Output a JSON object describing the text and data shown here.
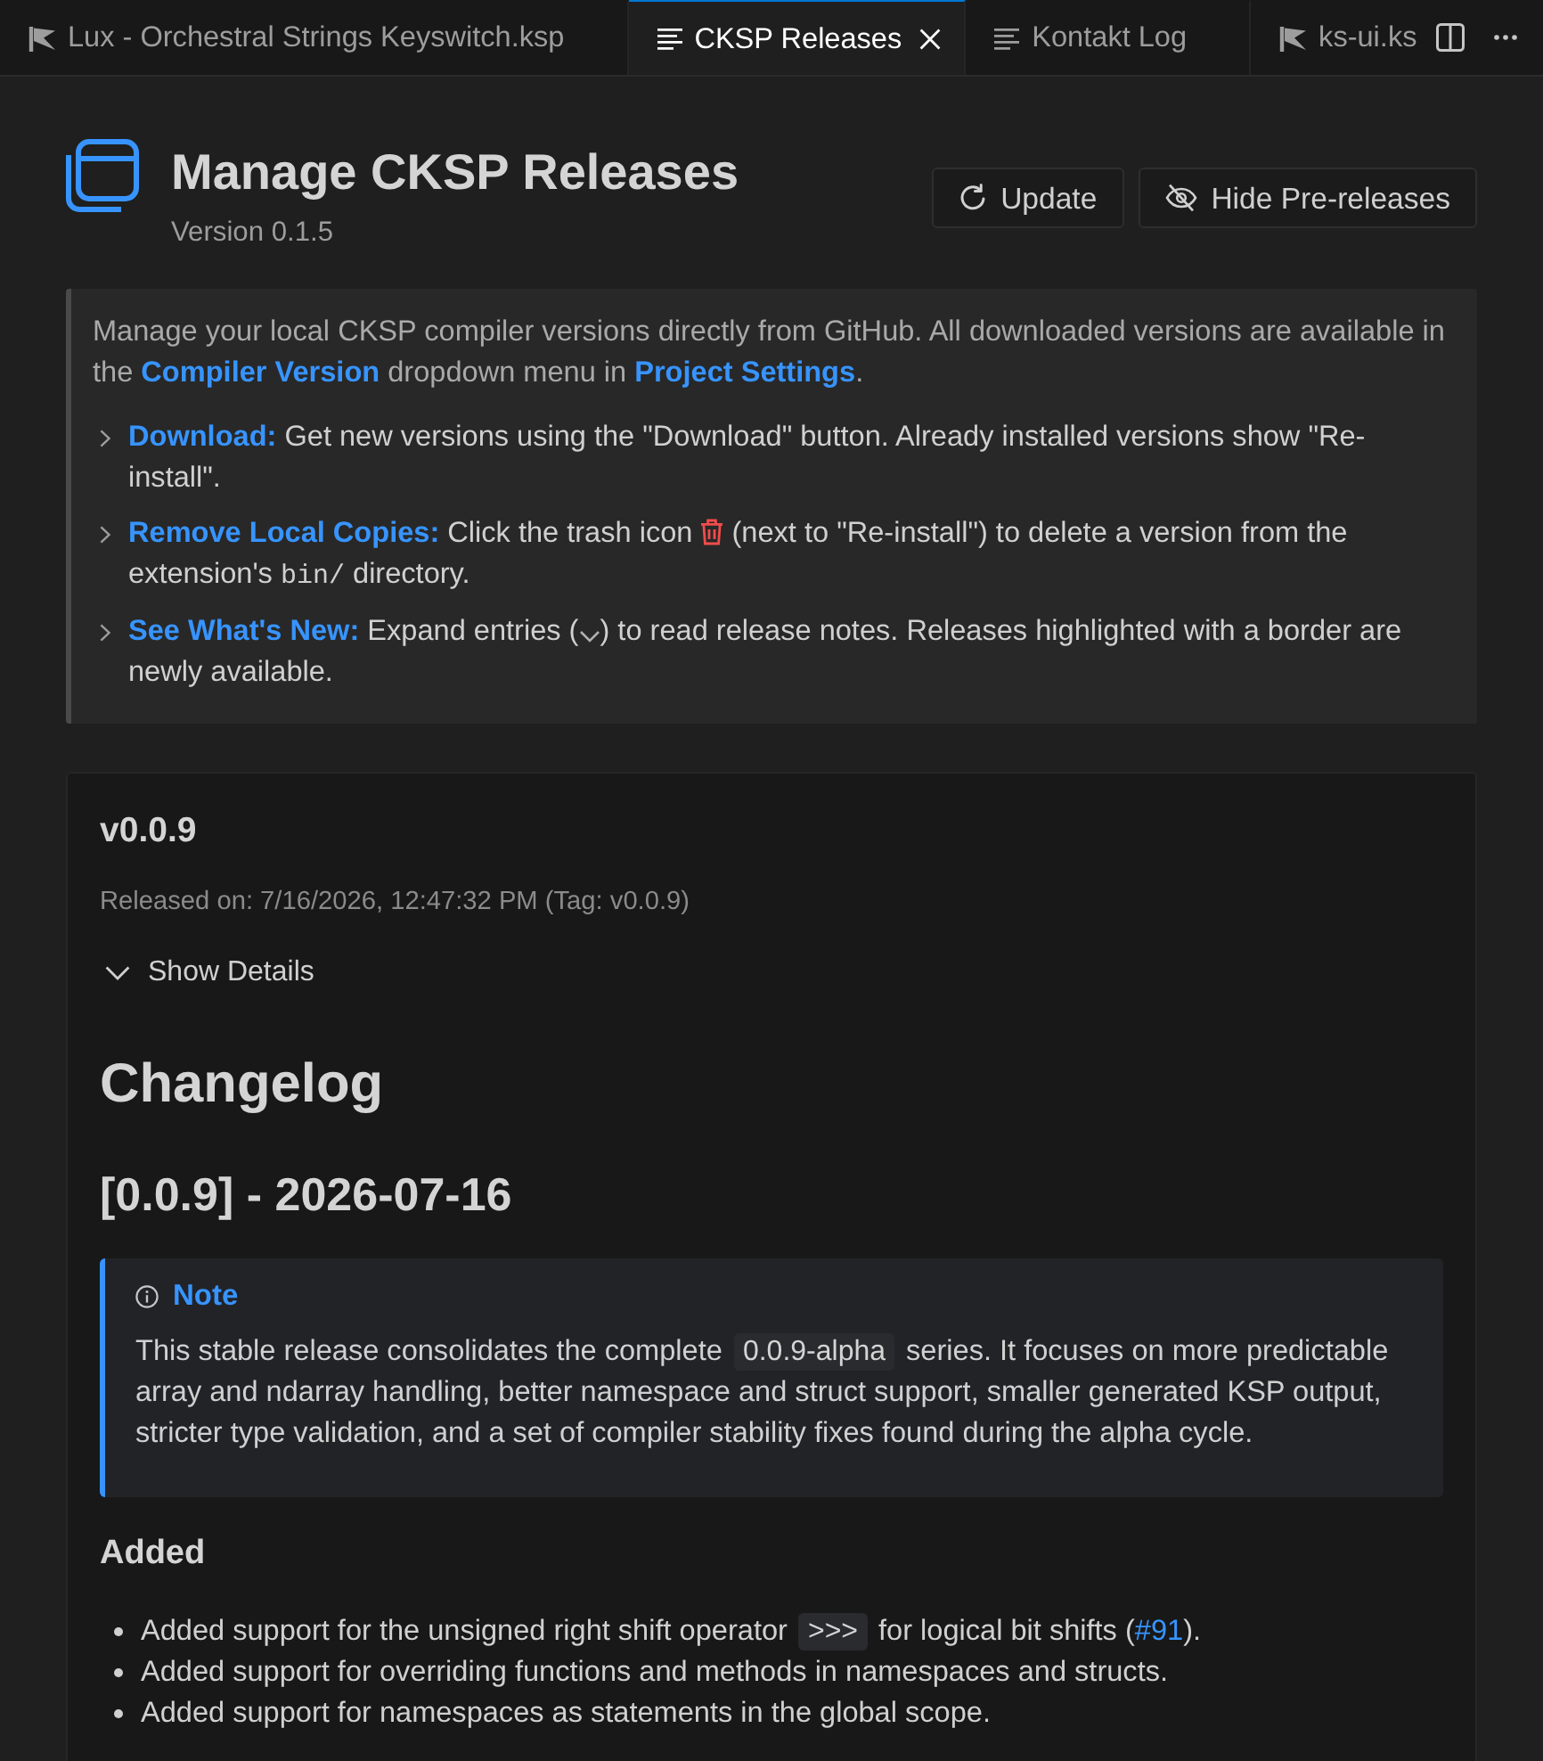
{
  "tabs": [
    {
      "label": "Lux - Orchestral Strings Keyswitch.ksp",
      "kind": "ksp",
      "selected": false
    },
    {
      "label": "CKSP Releases",
      "kind": "doc",
      "selected": true
    },
    {
      "label": "Kontakt Log",
      "kind": "doc",
      "selected": false
    },
    {
      "label": "ks-ui.ks",
      "kind": "ksp",
      "selected": false
    }
  ],
  "header": {
    "title": "Manage CKSP Releases",
    "version": "Version 0.1.5",
    "buttons": [
      {
        "label": "Update",
        "kind": "refresh"
      },
      {
        "label": "Hide Pre-releases",
        "kind": "eye-off"
      }
    ]
  },
  "info": {
    "intro": "Manage your local CKSP compiler versions directly from GitHub. All downloaded versions are available in the **Compiler Version** dropdown menu in **Project Settings**.",
    "tips": [
      {
        "parts": [
          {
            "kind": "text",
            "text": "**Download:** Get new versions using the \"Download\" button. Already installed versions show \"Re-install\"."
          }
        ]
      },
      {
        "parts": [
          {
            "kind": "text",
            "text": "**Remove Local Copies:** Click the trash icon "
          },
          {
            "kind": "trash"
          },
          {
            "kind": "text",
            "text": " (next to \"Re-install\") to delete a version from the extension's "
          },
          {
            "kind": "code",
            "text": "bin/"
          },
          {
            "kind": "text",
            "text": " directory."
          }
        ]
      },
      {
        "parts": [
          {
            "kind": "text",
            "text": "**See What's New:** Expand entries ("
          },
          {
            "kind": "chevron"
          },
          {
            "kind": "text",
            "text": ") to read release notes. Releases highlighted with a border are newly available."
          }
        ]
      }
    ]
  },
  "release": {
    "version": "v0.0.9",
    "released": "Released on: 7/16/2026, 12:47:32 PM (Tag: v0.0.9)",
    "toggle": "Show Details",
    "expanded": true,
    "changelog": [
      {
        "kind": "h1",
        "text": "Changelog"
      },
      {
        "kind": "h2",
        "text": "[0.0.9] - 2026-07-16"
      },
      {
        "kind": "note",
        "title": "Note",
        "parts": [
          {
            "kind": "text",
            "text": "This stable release consolidates the complete "
          },
          {
            "kind": "code",
            "text": "0.0.9-alpha"
          },
          {
            "kind": "text",
            "text": " series. It focuses on more predictable array and ndarray handling, better namespace and struct support, smaller generated KSP output, stricter type validation, and a set of compiler stability fixes found during the alpha cycle."
          }
        ]
      },
      {
        "kind": "h3",
        "text": "Added"
      },
      {
        "kind": "list",
        "items": [
          [
            {
              "kind": "text",
              "text": "Added support for the unsigned right shift operator "
            },
            {
              "kind": "code",
              "text": ">>>"
            },
            {
              "kind": "text",
              "text": " for logical bit shifts ("
            },
            {
              "kind": "link",
              "text": "#91"
            },
            {
              "kind": "text",
              "text": ")."
            }
          ],
          [
            {
              "kind": "text",
              "text": "Added support for overriding functions and methods in namespaces and structs."
            }
          ],
          [
            {
              "kind": "text",
              "text": "Added support for namespaces as statements in the global scope."
            }
          ]
        ]
      }
    ]
  }
}
